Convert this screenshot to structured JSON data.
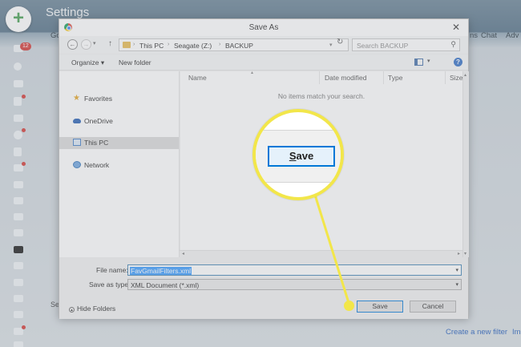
{
  "background": {
    "title": "Settings",
    "inbox_badge": "12",
    "tabs": [
      "Go",
      "ns",
      "Chat",
      "Adv"
    ],
    "bottom_links": [
      "Create a new filter",
      "Im"
    ],
    "left_label": "Se"
  },
  "dialog": {
    "title": "Save As",
    "breadcrumb": [
      "This PC",
      "Seagate (Z:)",
      "BACKUP"
    ],
    "search_placeholder": "Search BACKUP",
    "toolbar": {
      "organize": "Organize ▾",
      "new_folder": "New folder"
    },
    "nav_items": [
      {
        "label": "Favorites",
        "icon": "star-icon"
      },
      {
        "label": "OneDrive",
        "icon": "cloud-icon"
      },
      {
        "label": "This PC",
        "icon": "computer-icon",
        "selected": true
      },
      {
        "label": "Network",
        "icon": "network-icon"
      }
    ],
    "columns": [
      "Name",
      "Date modified",
      "Type",
      "Size"
    ],
    "empty_message": "No items match your search.",
    "file_name_label": "File name:",
    "file_name_value": "FavGmailFilters.xml",
    "save_type_label": "Save as type:",
    "save_type_value": "XML Document (*.xml)",
    "hide_folders": "Hide Folders",
    "save_button": "Save",
    "cancel_button": "Cancel"
  },
  "callout": {
    "magnified_button_label": "ave",
    "magnified_button_underlined": "S",
    "highlight_color": "#f2e64a"
  }
}
